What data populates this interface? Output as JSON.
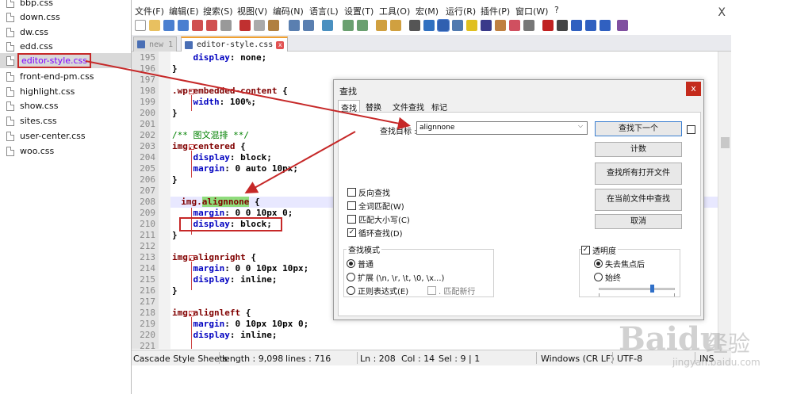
{
  "file_tree": {
    "items": [
      {
        "label": "bbp.css"
      },
      {
        "label": "down.css"
      },
      {
        "label": "dw.css"
      },
      {
        "label": "edd.css"
      },
      {
        "label": "editor-style.css"
      },
      {
        "label": "front-end-pm.css"
      },
      {
        "label": "highlight.css"
      },
      {
        "label": "show.css"
      },
      {
        "label": "sites.css"
      },
      {
        "label": "user-center.css"
      },
      {
        "label": "woo.css"
      }
    ],
    "selected_index": 4
  },
  "menubar": {
    "items": [
      "文件(F)",
      "编辑(E)",
      "搜索(S)",
      "视图(V)",
      "编码(N)",
      "语言(L)",
      "设置(T)",
      "工具(O)",
      "宏(M)",
      "运行(R)",
      "插件(P)",
      "窗口(W)",
      "?"
    ],
    "close_label": "X"
  },
  "tabs": [
    {
      "label": "new 1",
      "active": false
    },
    {
      "label": "editor-style.css",
      "active": true
    }
  ],
  "code": {
    "line_numbers": [
      "195",
      "196",
      "197",
      "198",
      "199",
      "200",
      "201",
      "202",
      "203",
      "204",
      "205",
      "206",
      "207",
      "208",
      "209",
      "210",
      "211",
      "212",
      "213",
      "214",
      "215",
      "216",
      "217",
      "218",
      "219",
      "220",
      "221"
    ]
  },
  "status": {
    "lang": "Cascade Style Sheets",
    "length": "length : 9,098",
    "lines": "lines : 716",
    "ln": "Ln : 208",
    "col": "Col : 14",
    "sel": "Sel : 9 | 1",
    "eol": "Windows (CR LF)",
    "enc": "UTF-8",
    "mode": "INS"
  },
  "find_dialog": {
    "title": "查找",
    "close_label": "x",
    "tabs": [
      "查找",
      "替换",
      "文件查找",
      "标记"
    ],
    "find_label": "查找目标 :",
    "find_value": "alignnone",
    "buttons": {
      "find_next": "查找下一个",
      "count": "计数",
      "find_all_open": "查找所有打开文件",
      "find_in_current": "在当前文件中查找",
      "cancel": "取消"
    },
    "options": [
      {
        "label": "反向查找",
        "checked": false
      },
      {
        "label": "全词匹配(W)",
        "checked": false
      },
      {
        "label": "匹配大小写(C)",
        "checked": false
      },
      {
        "label": "循环查找(D)",
        "checked": true
      }
    ],
    "search_mode": {
      "title": "查找模式",
      "normal": "普通",
      "extended": "扩展 (\\n, \\r, \\t, \\0, \\x...)",
      "regex": "正则表达式(E)",
      "newline": ". 匹配新行",
      "selected": "normal"
    },
    "transparency": {
      "title": "透明度",
      "checked": true,
      "on_lose_focus": "失去焦点后",
      "always": "始终",
      "selected": "on_lose_focus",
      "slider_fraction": 0.7
    }
  },
  "watermark": {
    "brand": "Baidu",
    "cn": "经验",
    "url": "jingyan.baidu.com"
  },
  "colors": {
    "highlight_red": "#c62828",
    "match_green": "#8fdc7c",
    "selector": "#800000",
    "property": "#0000c0",
    "comment": "#008000"
  }
}
